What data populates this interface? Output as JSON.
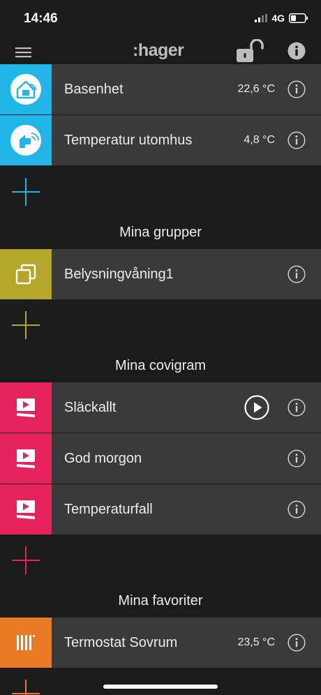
{
  "status": {
    "time": "14:46",
    "network": "4G"
  },
  "header": {
    "logo": ":hager"
  },
  "colors": {
    "blue": "#22b6e8",
    "olive": "#b3a628",
    "pink": "#e3235a",
    "orange": "#ea7a23",
    "row_bg": "#3a3a3a",
    "page_bg": "#1b1b1b"
  },
  "devices": [
    {
      "label": "Basenhet",
      "value": "22,6 °C",
      "icon": "base-unit-icon"
    },
    {
      "label": "Temperatur utomhus",
      "value": "4,8 °C",
      "icon": "outdoor-sensor-icon"
    }
  ],
  "groups": {
    "title": "Mina grupper",
    "items": [
      {
        "label": "Belysningvåning1",
        "icon": "group-icon"
      }
    ]
  },
  "scenarios": {
    "title": "Mina covigram",
    "items": [
      {
        "label": "Släckallt",
        "icon": "scenario-icon",
        "playable": true
      },
      {
        "label": "God morgon",
        "icon": "scenario-icon"
      },
      {
        "label": "Temperaturfall",
        "icon": "scenario-icon"
      }
    ]
  },
  "favorites": {
    "title": "Mina favoriter",
    "items": [
      {
        "label": "Termostat Sovrum",
        "value": "23,5 °C",
        "icon": "radiator-icon"
      }
    ]
  }
}
